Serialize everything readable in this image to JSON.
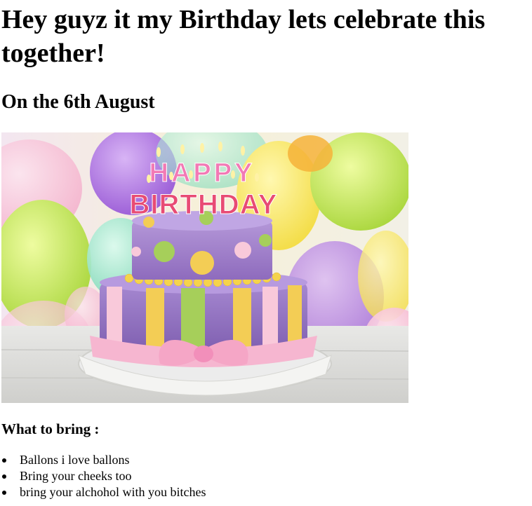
{
  "heading": "Hey guyz it my Birthday lets celebrate this together!",
  "date_heading": "On the 6th August",
  "image": {
    "description_icon": "birthday-cake-image",
    "cake_topper_top": "HAPPY",
    "cake_topper_bottom": "BIRTHDAY"
  },
  "bring_heading": "What to bring :",
  "bring_items": [
    "Ballons i love ballons",
    "Bring your cheeks too",
    "bring your alchohol with you bitches"
  ]
}
